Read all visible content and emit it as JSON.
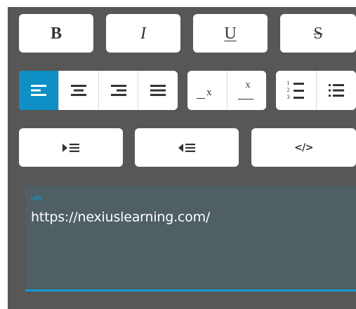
{
  "toolbar": {
    "row1": {
      "bold_label": "B",
      "italic_label": "I",
      "underline_label": "U",
      "strikethrough_label": "S"
    },
    "alignment": {
      "selected": "align-left",
      "options": [
        "align-left",
        "align-center",
        "align-right",
        "align-justify"
      ]
    },
    "script": {
      "subscript_label": "x",
      "superscript_label": "x"
    },
    "lists": {
      "ordered_markers": [
        "1",
        "2",
        "3"
      ],
      "options": [
        "ordered-list",
        "bullet-list"
      ]
    },
    "row3": {
      "indent_icon": "indent-icon",
      "outdent_icon": "outdent-icon",
      "code_label": "</>"
    }
  },
  "url_field": {
    "label": "URL",
    "value": "https://nexiuslearning.com/"
  },
  "colors": {
    "panel_bg": "#575757",
    "button_bg": "#ffffff",
    "accent": "#0e8fc5",
    "field_bg": "#4f5f63",
    "field_underline": "#159ad3"
  }
}
